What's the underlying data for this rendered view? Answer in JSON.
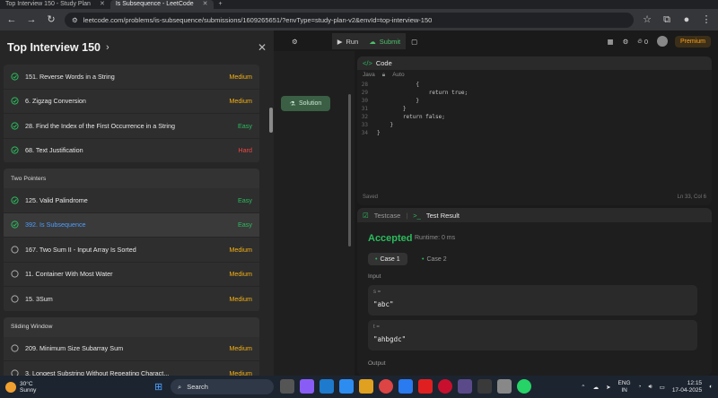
{
  "browser": {
    "tabs": [
      {
        "label": "Top Interview 150 - Study Plan",
        "active": false
      },
      {
        "label": "Is Subsequence - LeetCode",
        "active": true
      }
    ],
    "url": "leetcode.com/problems/is-subsequence/submissions/1609265651/?envType=study-plan-v2&envId=top-interview-150"
  },
  "panel": {
    "title": "Top Interview 150",
    "groups": [
      {
        "section": "",
        "items": [
          {
            "title": "151. Reverse Words in a String",
            "difficulty": "Medium",
            "level": "medium",
            "status": "solved"
          },
          {
            "title": "6. Zigzag Conversion",
            "difficulty": "Medium",
            "level": "medium",
            "status": "solved"
          },
          {
            "title": "28. Find the Index of the First Occurrence in a String",
            "difficulty": "Easy",
            "level": "easy",
            "status": "solved"
          },
          {
            "title": "68. Text Justification",
            "difficulty": "Hard",
            "level": "hard",
            "status": "solved"
          }
        ]
      },
      {
        "section": "Two Pointers",
        "items": [
          {
            "title": "125. Valid Palindrome",
            "difficulty": "Easy",
            "level": "easy",
            "status": "solved"
          },
          {
            "title": "392. Is Subsequence",
            "difficulty": "Easy",
            "level": "easy",
            "status": "solved",
            "selected": true
          },
          {
            "title": "167. Two Sum II - Input Array Is Sorted",
            "difficulty": "Medium",
            "level": "medium",
            "status": "todo"
          },
          {
            "title": "11. Container With Most Water",
            "difficulty": "Medium",
            "level": "medium",
            "status": "todo"
          },
          {
            "title": "15. 3Sum",
            "difficulty": "Medium",
            "level": "medium",
            "status": "todo"
          }
        ]
      },
      {
        "section": "Sliding Window",
        "items": [
          {
            "title": "209. Minimum Size Subarray Sum",
            "difficulty": "Medium",
            "level": "medium",
            "status": "todo"
          },
          {
            "title": "3. Longest Substring Without Repeating Charact...",
            "difficulty": "Medium",
            "level": "medium",
            "status": "todo"
          }
        ]
      }
    ]
  },
  "toolbar": {
    "run": "Run",
    "submit": "Submit",
    "streak": "0",
    "premium": "Premium"
  },
  "solution_button": "Solution",
  "code": {
    "tab": "Code",
    "language": "Java",
    "mode": "Auto",
    "lines": [
      {
        "n": "28",
        "text": "            {"
      },
      {
        "n": "29",
        "text": "                return true;"
      },
      {
        "n": "30",
        "text": "            }"
      },
      {
        "n": "31",
        "text": "        }"
      },
      {
        "n": "32",
        "text": "        return false;"
      },
      {
        "n": "33",
        "text": "    }"
      },
      {
        "n": "34",
        "text": "}"
      }
    ],
    "status": "Saved",
    "cursor": "Ln 33, Col 6"
  },
  "test": {
    "tab_testcase": "Testcase",
    "tab_result": "Test Result",
    "verdict": "Accepted",
    "runtime": "Runtime: 0 ms",
    "case1": "Case 1",
    "case2": "Case 2",
    "input_label": "Input",
    "s_label": "s =",
    "s_value": "\"abc\"",
    "t_label": "t =",
    "t_value": "\"ahbgdc\"",
    "output_label": "Output"
  },
  "taskbar": {
    "temp": "30°C",
    "weather": "Sunny",
    "search": "Search",
    "lang1": "ENG",
    "lang2": "IN",
    "time": "12:15",
    "date": "17-04-2025"
  },
  "colors": {
    "medium": "#f5b014",
    "easy": "#2cbb5d",
    "hard": "#ef4743",
    "accepted": "#2cbb5d",
    "premium": "#ffa116"
  }
}
